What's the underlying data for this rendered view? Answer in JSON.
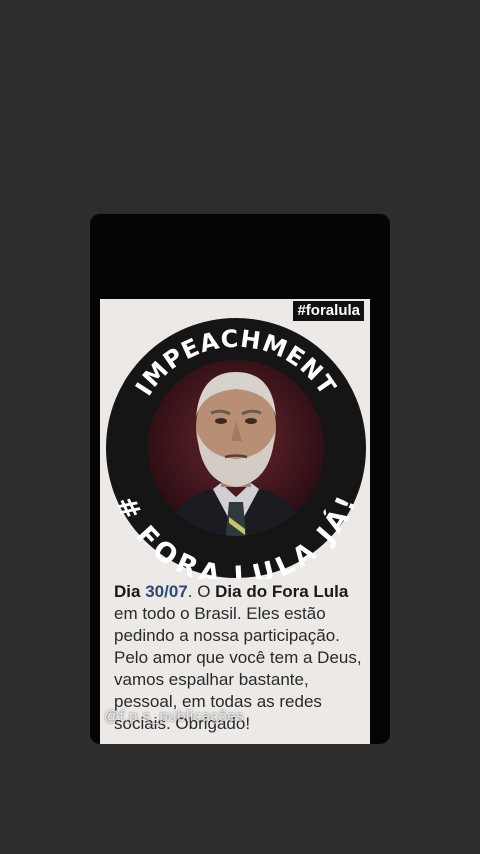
{
  "post": {
    "hashtag": "#foralula",
    "badge_top_text": "IMPEACHMENT",
    "badge_bottom_text": "# FORA LULA JÁ!",
    "caption": {
      "day_label": "Dia",
      "date": "30/07",
      "mid": ". O",
      "highlight": "Dia do Fora Lula",
      "rest": "em todo o Brasil. Eles estão pedindo a nossa participação. Pelo amor que você tem a Deus, vamos espalhar bastante, pessoal, em todas as redes sociais. Obrigado!"
    },
    "watermark": "@f.p.s_publicações"
  },
  "colors": {
    "page_bg": "#2e2d2d",
    "story_bg": "#050505",
    "card_bg": "#ece9e6",
    "badge_ring": "#151515",
    "badge_inner": "#4a1a22",
    "date_accent": "#2f4a78"
  }
}
